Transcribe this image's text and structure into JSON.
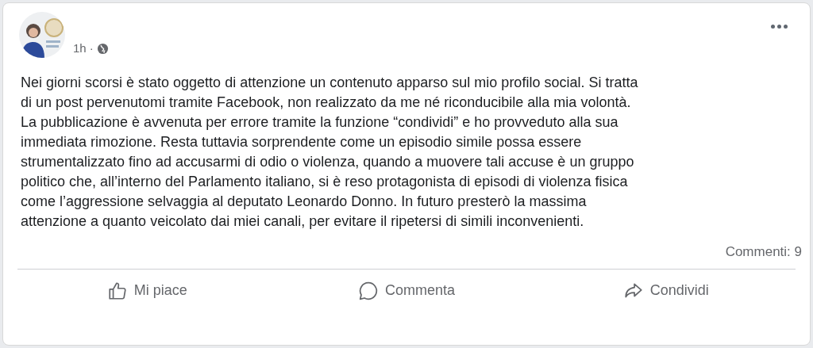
{
  "post": {
    "time": "1h ·",
    "text_lines": [
      "Nei giorni scorsi è stato oggetto di attenzione un contenuto apparso sul mio profilo social. Si tratta",
      "di un post pervenutomi tramite Facebook, non realizzato da me né riconducibile alla mia volontà.",
      "La pubblicazione è avvenuta per errore tramite la funzione “condividi” e ho provveduto alla sua",
      "immediata rimozione. Resta tuttavia sorprendente come un episodio simile possa essere",
      "strumentalizzato fino ad accusarmi di odio o violenza, quando a muovere tali accuse è un gruppo",
      "politico che, all’interno del Parlamento italiano, si è reso protagonista di episodi di violenza fisica",
      "come l’aggressione selvaggia al deputato Leonardo Donno. In futuro presterò la massima",
      "attenzione a quanto veicolato dai miei canali, per evitare il ripetersi di simili inconvenienti."
    ],
    "comments": "Commenti: 9"
  },
  "actions": [
    {
      "kind": "like",
      "label": "Mi piace"
    },
    {
      "kind": "comment",
      "label": "Commenta"
    },
    {
      "kind": "share",
      "label": "Condividi"
    }
  ]
}
